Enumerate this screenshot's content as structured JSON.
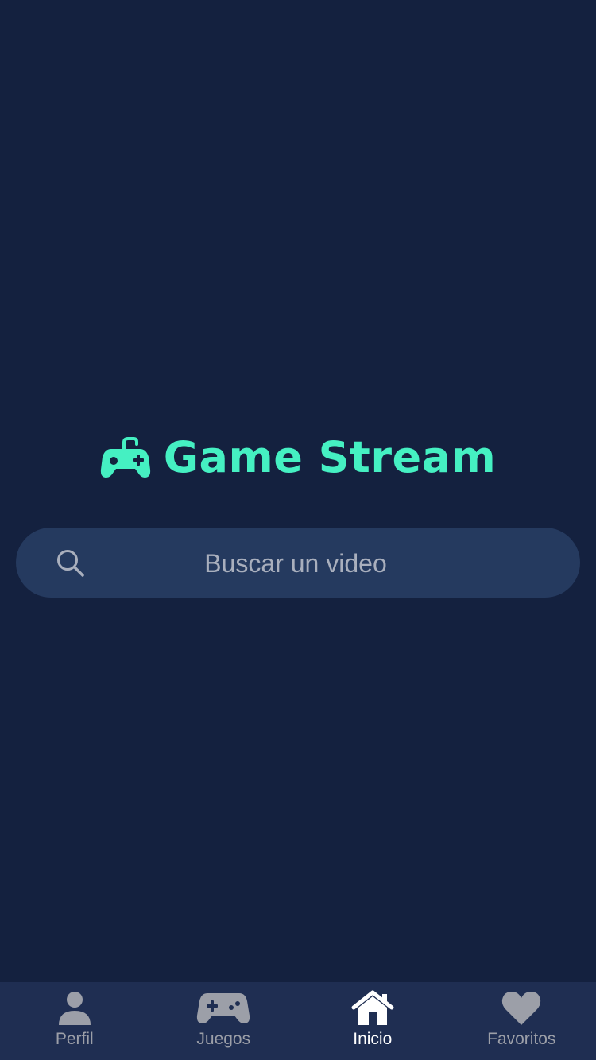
{
  "app": {
    "title": "Game Stream"
  },
  "search": {
    "placeholder": "Buscar un video",
    "value": ""
  },
  "tabs": [
    {
      "label": "Perfil",
      "icon": "person-icon",
      "active": false
    },
    {
      "label": "Juegos",
      "icon": "gamepad-icon",
      "active": false
    },
    {
      "label": "Inicio",
      "icon": "home-icon",
      "active": true
    },
    {
      "label": "Favoritos",
      "icon": "heart-icon",
      "active": false
    }
  ],
  "colors": {
    "background": "#14213f",
    "accent": "#45f0c2",
    "search_background": "#253a5f",
    "tabbar_background": "#1f2e52",
    "tab_inactive": "#9c9fa8",
    "tab_active": "#ffffff"
  }
}
